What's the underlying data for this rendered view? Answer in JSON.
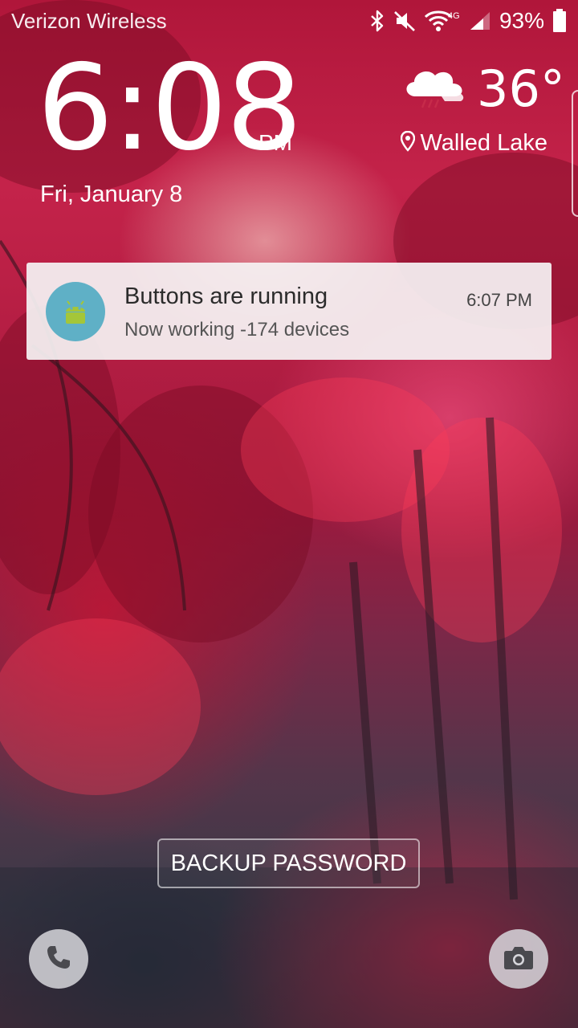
{
  "status_bar": {
    "carrier": "Verizon Wireless",
    "network_type": "4G",
    "battery_percent": "93%",
    "icons": [
      "bluetooth-icon",
      "mute-icon",
      "wifi-icon",
      "signal-icon",
      "battery-icon"
    ]
  },
  "clock": {
    "time": "6:08",
    "ampm": "PM",
    "date": "Fri, January 8"
  },
  "weather": {
    "temperature": "36°",
    "location": "Walled Lake",
    "condition_icon": "rain-cloud-icon"
  },
  "notification": {
    "app_icon": "android-icon",
    "title": "Buttons are running",
    "text": "Now working -174 devices",
    "time": "6:07 PM",
    "icon_color": "#5fb0c6"
  },
  "actions": {
    "backup_password": "BACKUP PASSWORD",
    "phone_icon": "phone-icon",
    "camera_icon": "camera-icon"
  }
}
